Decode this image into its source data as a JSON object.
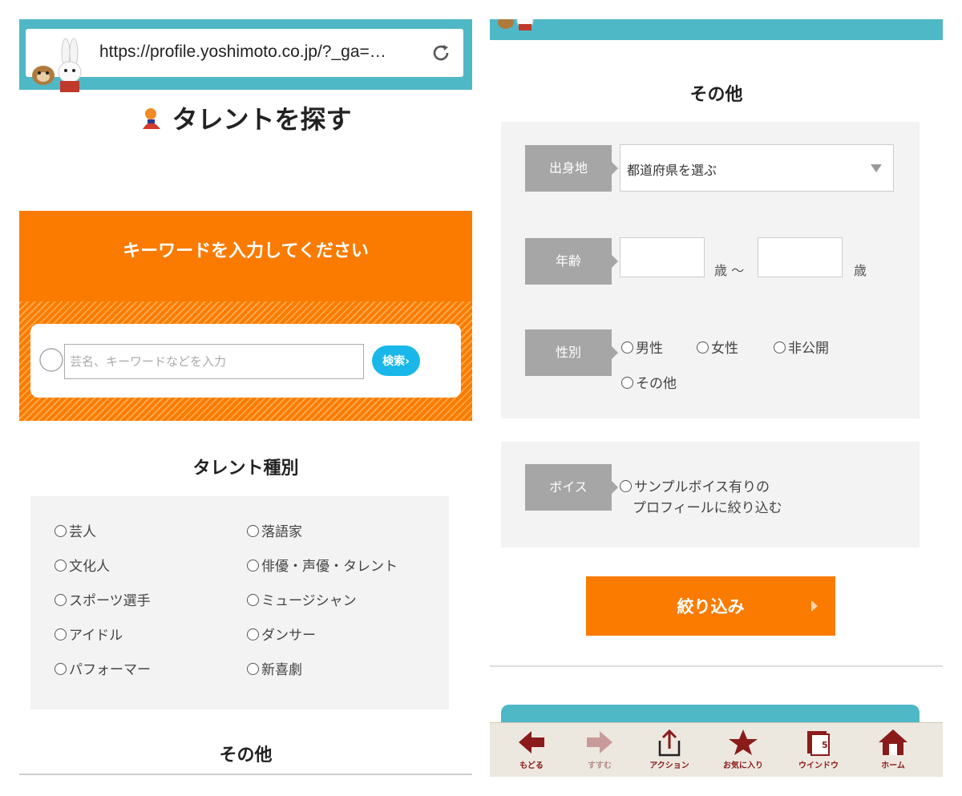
{
  "left": {
    "browser": {
      "url": "https://profile.yoshimoto.co.jp/?_ga=…"
    },
    "page_title": "タレントを探す",
    "keyword": {
      "heading": "キーワードを入力してください",
      "placeholder": "芸名、キーワードなどを入力",
      "search_button": "検索›"
    },
    "talent_type": {
      "heading": "タレント種別",
      "options": [
        "芸人",
        "落語家",
        "文化人",
        "俳優・声優・タレント",
        "スポーツ選手",
        "ミュージシャン",
        "アイドル",
        "ダンサー",
        "パフォーマー",
        "新喜劇"
      ]
    },
    "other_heading": "その他"
  },
  "right": {
    "other_heading": "その他",
    "birthplace": {
      "label": "出身地",
      "value": "都道府県を選ぶ"
    },
    "age": {
      "label": "年齢",
      "unit": "歳",
      "tilde": "〜"
    },
    "gender": {
      "label": "性別",
      "options": [
        "男性",
        "女性",
        "非公開",
        "その他"
      ]
    },
    "voice": {
      "label": "ボイス",
      "line1": "サンプルボイス有りの",
      "line2": "プロフィールに絞り込む"
    },
    "narrow_button": "絞り込み",
    "toolbar": {
      "back": "もどる",
      "forward": "すすむ",
      "action": "アクション",
      "favorites": "お気に入り",
      "window": "ウインドウ",
      "window_count": "5",
      "home": "ホーム"
    }
  },
  "colors": {
    "teal": "#4fb8c6",
    "orange": "#fb7b00",
    "search_blue": "#1ab7ea",
    "tag_gray": "#a6a6a6",
    "toolbar_red": "#8b1b1b"
  }
}
